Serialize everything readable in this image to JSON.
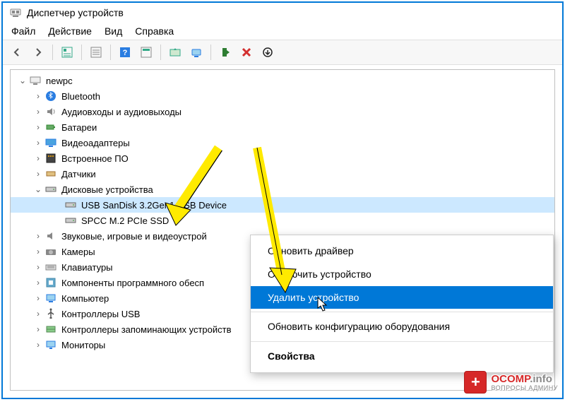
{
  "window": {
    "title": "Диспетчер устройств"
  },
  "menu": {
    "file": "Файл",
    "action": "Действие",
    "view": "Вид",
    "help": "Справка"
  },
  "tree": {
    "root": "newpc",
    "items": [
      {
        "label": "Bluetooth",
        "icon": "bluetooth"
      },
      {
        "label": "Аудиовходы и аудиовыходы",
        "icon": "audio"
      },
      {
        "label": "Батареи",
        "icon": "battery"
      },
      {
        "label": "Видеоадаптеры",
        "icon": "display"
      },
      {
        "label": "Встроенное ПО",
        "icon": "firmware"
      },
      {
        "label": "Датчики",
        "icon": "sensor"
      },
      {
        "label": "Дисковые устройства",
        "icon": "disk",
        "expanded": true,
        "children": [
          {
            "label": "USB  SanDisk 3.2Gen1 USB Device",
            "icon": "disk",
            "selected": true
          },
          {
            "label": "SPCC M.2 PCIe SSD",
            "icon": "disk"
          }
        ]
      },
      {
        "label": "Звуковые, игровые и видеоустрой",
        "icon": "audio"
      },
      {
        "label": "Камеры",
        "icon": "camera"
      },
      {
        "label": "Клавиатуры",
        "icon": "keyboard"
      },
      {
        "label": "Компоненты программного обесп",
        "icon": "software"
      },
      {
        "label": "Компьютер",
        "icon": "computer"
      },
      {
        "label": "Контроллеры USB",
        "icon": "usb"
      },
      {
        "label": "Контроллеры запоминающих устройств",
        "icon": "storage"
      },
      {
        "label": "Мониторы",
        "icon": "monitor"
      }
    ]
  },
  "context_menu": {
    "update": "Обновить драйвер",
    "disable": "Отключить устройство",
    "remove": "Удалить устройство",
    "scan": "Обновить конфигурацию оборудования",
    "props": "Свойства"
  },
  "watermark": {
    "brand": "OCOMP",
    "tld": ".info",
    "tagline": "ВОПРОСЫ АДМИНУ"
  }
}
